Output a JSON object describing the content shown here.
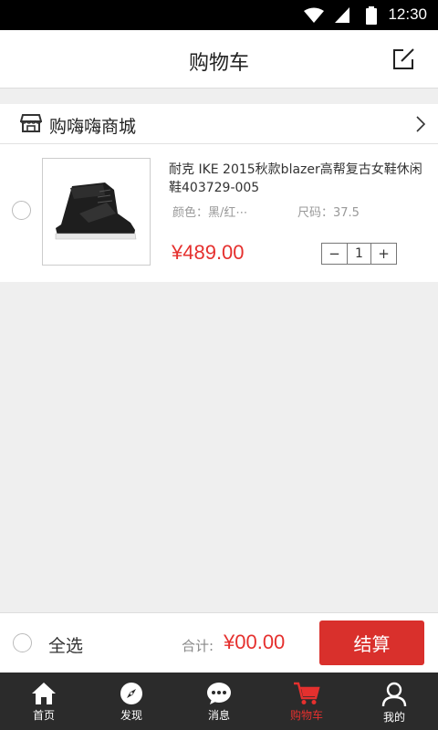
{
  "status_bar": {
    "time": "12:30"
  },
  "header": {
    "title": "购物车",
    "edit_icon": "edit-icon"
  },
  "shop": {
    "name": "购嗨嗨商城",
    "icon": "store-icon"
  },
  "cart_item": {
    "name": "耐克 IKE 2015秋款blazer高帮复古女鞋休闲鞋403729-005",
    "color": "颜色：黑/红⋯",
    "size": "尺码：37.5",
    "price": "¥489.00",
    "quantity": "1",
    "minus": "−",
    "plus": "+"
  },
  "footer": {
    "select_all": "全选",
    "total_label": "合计:",
    "total_value": "¥00.00",
    "checkout": "结算"
  },
  "tabs": [
    {
      "label": "首页",
      "icon": "home-icon",
      "active": false
    },
    {
      "label": "发现",
      "icon": "compass-icon",
      "active": false
    },
    {
      "label": "消息",
      "icon": "chat-icon",
      "active": false
    },
    {
      "label": "购物车",
      "icon": "cart-icon",
      "active": true
    },
    {
      "label": "我的",
      "icon": "person-icon",
      "active": false
    }
  ],
  "colors": {
    "accent": "#e5302e",
    "checkout": "#d9302c",
    "tabbar": "#2b2b2b"
  }
}
